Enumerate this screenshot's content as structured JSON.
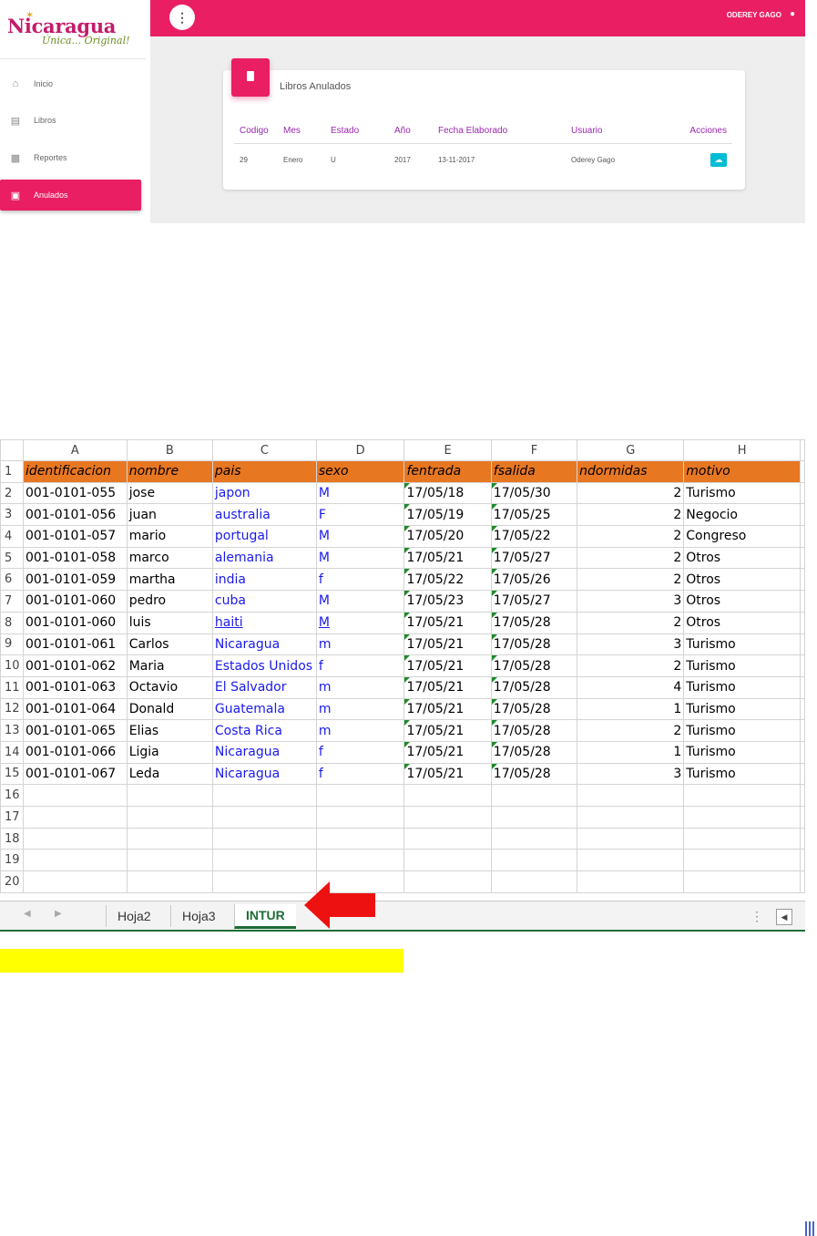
{
  "app": {
    "logo": {
      "word": "Nicaragua",
      "tagline": "Única... Original!"
    },
    "sidebar": {
      "items": [
        {
          "label": "Inicio",
          "icon": "home-icon",
          "active": false
        },
        {
          "label": "Libros",
          "icon": "book-list-icon",
          "active": false
        },
        {
          "label": "Reportes",
          "icon": "chart-icon",
          "active": false
        },
        {
          "label": "Anulados",
          "icon": "archive-icon",
          "active": true
        }
      ]
    },
    "topbar": {
      "menu_glyph": "⋮",
      "user_name": "ODEREY GAGO",
      "user_icon": "person-icon"
    },
    "card": {
      "title": "Libros Anulados",
      "columns": [
        "Codigo",
        "Mes",
        "Estado",
        "Año",
        "Fecha Elaborado",
        "Usuario",
        "Acciones"
      ],
      "rows": [
        {
          "codigo": "29",
          "mes": "Enero",
          "estado": "U",
          "anio": "2017",
          "fecha": "13-11-2017",
          "usuario": "Oderey Gago",
          "accion_icon": "cloud-download-icon"
        }
      ]
    },
    "colors": {
      "accent": "#e91e63",
      "header_text": "#9c27b0",
      "action": "#00bcd4"
    }
  },
  "sheet": {
    "col_letters": [
      "A",
      "B",
      "C",
      "D",
      "E",
      "F",
      "G",
      "H"
    ],
    "header_row": [
      "identificacion",
      "nombre",
      "pais",
      "sexo",
      "fentrada",
      "fsalida",
      "ndormidas",
      "motivo"
    ],
    "rows": [
      [
        "001-0101-055",
        "jose",
        "japon",
        "M",
        "17/05/18",
        "17/05/30",
        "2",
        "Turismo"
      ],
      [
        "001-0101-056",
        "juan",
        "australia",
        "F",
        "17/05/19",
        "17/05/25",
        "2",
        "Negocio"
      ],
      [
        "001-0101-057",
        "mario",
        "portugal",
        "M",
        "17/05/20",
        "17/05/22",
        "2",
        "Congreso"
      ],
      [
        "001-0101-058",
        "marco",
        "alemania",
        "M",
        "17/05/21",
        "17/05/27",
        "2",
        "Otros"
      ],
      [
        "001-0101-059",
        "martha",
        "india",
        "f",
        "17/05/22",
        "17/05/26",
        "2",
        "Otros"
      ],
      [
        "001-0101-060",
        "pedro",
        "cuba",
        "M",
        "17/05/23",
        "17/05/27",
        "3",
        "Otros"
      ],
      [
        "001-0101-060",
        "luis",
        "haiti",
        "M",
        "17/05/21",
        "17/05/28",
        "2",
        "Otros"
      ],
      [
        "001-0101-061",
        "Carlos",
        "Nicaragua",
        "m",
        "17/05/21",
        "17/05/28",
        "3",
        "Turismo"
      ],
      [
        "001-0101-062",
        "Maria",
        "Estados Unidos",
        "f",
        "17/05/21",
        "17/05/28",
        "2",
        "Turismo"
      ],
      [
        "001-0101-063",
        "Octavio",
        "El Salvador",
        "m",
        "17/05/21",
        "17/05/28",
        "4",
        "Turismo"
      ],
      [
        "001-0101-064",
        "Donald",
        "Guatemala",
        "m",
        "17/05/21",
        "17/05/28",
        "1",
        "Turismo"
      ],
      [
        "001-0101-065",
        "Elias",
        "Costa Rica",
        "m",
        "17/05/21",
        "17/05/28",
        "2",
        "Turismo"
      ],
      [
        "001-0101-066",
        "Ligia",
        "Nicaragua",
        "f",
        "17/05/21",
        "17/05/28",
        "1",
        "Turismo"
      ],
      [
        "001-0101-067",
        "Leda",
        "Nicaragua",
        "f",
        "17/05/21",
        "17/05/28",
        "3",
        "Turismo"
      ]
    ],
    "empty_rows": 5,
    "underlined_row": 7,
    "tabs": [
      {
        "label": "Hoja2",
        "active": false
      },
      {
        "label": "Hoja3",
        "active": false
      },
      {
        "label": "INTUR",
        "active": true
      }
    ],
    "colors": {
      "header_fill": "#e87722",
      "link_text": "#1a1aee",
      "active_tab": "#1d6e37",
      "arrow": "#ee1111"
    }
  },
  "annotations": {
    "highlight_color": "#ffff00"
  }
}
